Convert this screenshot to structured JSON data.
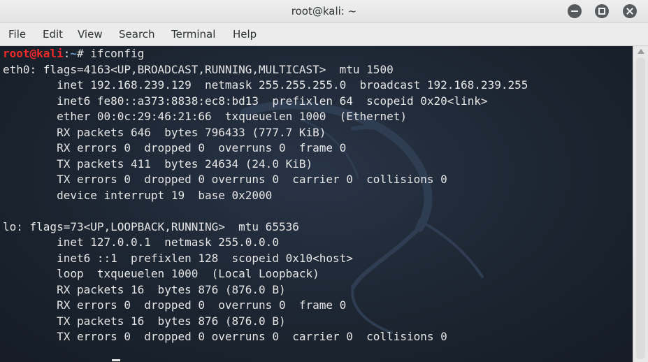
{
  "window": {
    "title": "root@kali: ~"
  },
  "menu": [
    "File",
    "Edit",
    "View",
    "Search",
    "Terminal",
    "Help"
  ],
  "prompt": {
    "user_host": "root@kali",
    "separator": ":",
    "path": "~",
    "symbol": "# ",
    "command": "ifconfig"
  },
  "output": [
    "eth0: flags=4163<UP,BROADCAST,RUNNING,MULTICAST>  mtu 1500",
    "        inet 192.168.239.129  netmask 255.255.255.0  broadcast 192.168.239.255",
    "        inet6 fe80::a373:8838:ec8:bd13  prefixlen 64  scopeid 0x20<link>",
    "        ether 00:0c:29:46:21:66  txqueuelen 1000  (Ethernet)",
    "        RX packets 646  bytes 796433 (777.7 KiB)",
    "        RX errors 0  dropped 0  overruns 0  frame 0",
    "        TX packets 411  bytes 24634 (24.0 KiB)",
    "        TX errors 0  dropped 0 overruns 0  carrier 0  collisions 0",
    "        device interrupt 19  base 0x2000",
    "",
    "lo: flags=73<UP,LOOPBACK,RUNNING>  mtu 65536",
    "        inet 127.0.0.1  netmask 255.0.0.0",
    "        inet6 ::1  prefixlen 128  scopeid 0x10<host>",
    "        loop  txqueuelen 1000  (Local Loopback)",
    "        RX packets 16  bytes 876 (876.0 B)",
    "        RX errors 0  dropped 0  overruns 0  frame 0",
    "        TX packets 16  bytes 876 (876.0 B)",
    "        TX errors 0  dropped 0 overruns 0  carrier 0  collisions 0"
  ],
  "colors": {
    "terminal_bg": "#1c2531",
    "prompt_user": "#ef2929",
    "prompt_path": "#729fcf",
    "text": "#e6e6e6"
  }
}
